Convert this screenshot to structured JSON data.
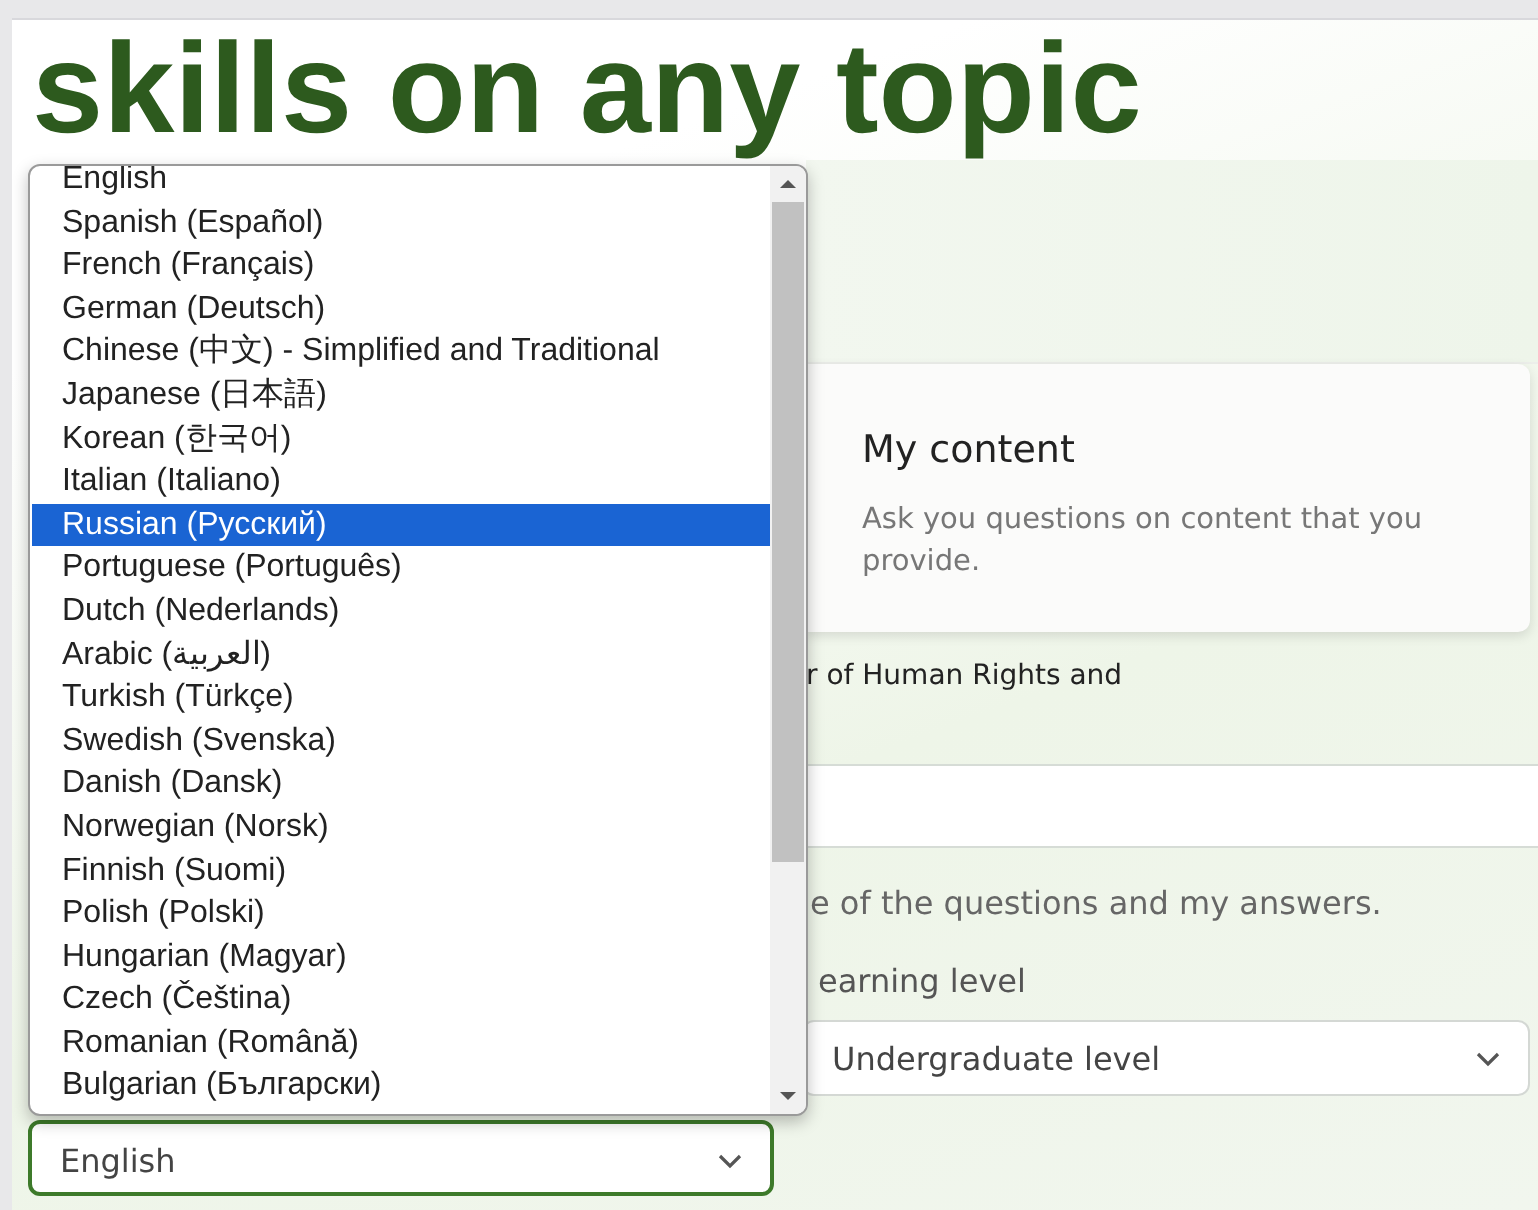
{
  "hero": {
    "heading": "skills on any topic"
  },
  "language_list": {
    "items": [
      {
        "label": "English",
        "selected": false
      },
      {
        "label": "Spanish (Español)",
        "selected": false
      },
      {
        "label": "French (Français)",
        "selected": false
      },
      {
        "label": "German (Deutsch)",
        "selected": false
      },
      {
        "label": "Chinese (中文) - Simplified and Traditional",
        "selected": false
      },
      {
        "label": "Japanese (日本語)",
        "selected": false
      },
      {
        "label": "Korean (한국어)",
        "selected": false
      },
      {
        "label": "Italian (Italiano)",
        "selected": false
      },
      {
        "label": "Russian (Русский)",
        "selected": true
      },
      {
        "label": "Portuguese (Português)",
        "selected": false
      },
      {
        "label": "Dutch (Nederlands)",
        "selected": false
      },
      {
        "label": "Arabic (العربية)",
        "selected": false
      },
      {
        "label": "Turkish (Türkçe)",
        "selected": false
      },
      {
        "label": "Swedish (Svenska)",
        "selected": false
      },
      {
        "label": "Danish (Dansk)",
        "selected": false
      },
      {
        "label": "Norwegian (Norsk)",
        "selected": false
      },
      {
        "label": "Finnish (Suomi)",
        "selected": false
      },
      {
        "label": "Polish (Polski)",
        "selected": false
      },
      {
        "label": "Hungarian (Magyar)",
        "selected": false
      },
      {
        "label": "Czech (Čeština)",
        "selected": false
      },
      {
        "label": "Romanian (Română)",
        "selected": false
      },
      {
        "label": "Bulgarian (Български)",
        "selected": false
      }
    ]
  },
  "source_card": {
    "title": "My content",
    "description": "Ask you questions on content that you provide."
  },
  "content_text": "r of Human Rights and",
  "feedback_text": "e of the questions and my answers.",
  "learning_level": {
    "label": "earning level"
  },
  "language_select": {
    "value": "English"
  },
  "level_select": {
    "value": "Undergraduate level"
  }
}
